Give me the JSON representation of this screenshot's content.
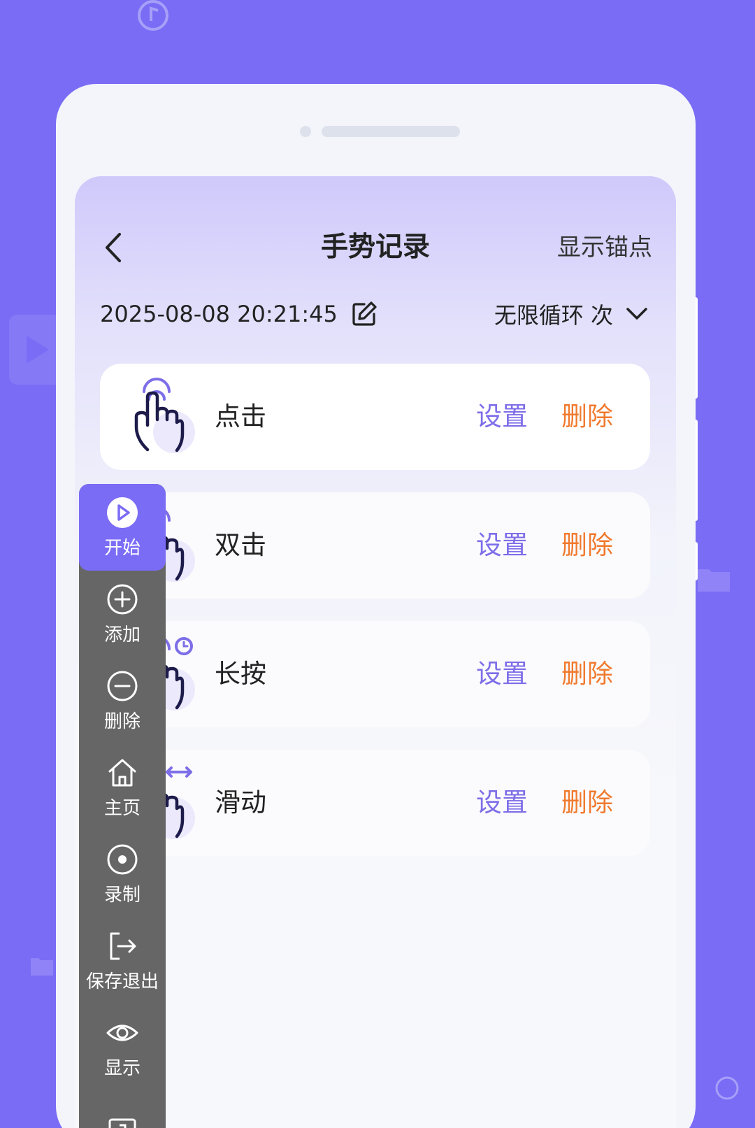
{
  "header": {
    "title": "手势记录",
    "anchor_label": "显示锚点"
  },
  "record": {
    "datetime": "2025-08-08 20:21:45",
    "loop_value": "无限循环 次"
  },
  "gestures": [
    {
      "label": "点击",
      "icon": "tap-hand-icon",
      "set": "设置",
      "delete": "删除"
    },
    {
      "label": "双击",
      "icon": "double-tap-hand-icon",
      "set": "设置",
      "delete": "删除"
    },
    {
      "label": "长按",
      "icon": "long-press-hand-icon",
      "set": "设置",
      "delete": "删除"
    },
    {
      "label": "滑动",
      "icon": "swipe-hand-icon",
      "set": "设置",
      "delete": "删除"
    }
  ],
  "toolbar": {
    "start": "开始",
    "add": "添加",
    "delete": "删除",
    "home": "主页",
    "record": "录制",
    "save_exit": "保存退出",
    "show": "显示"
  },
  "colors": {
    "background": "#7a6cf5",
    "accent": "#7d6ee8",
    "delete": "#f07a2e",
    "toolbar": "#666666"
  }
}
